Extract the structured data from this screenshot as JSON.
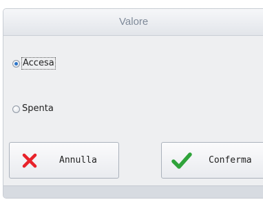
{
  "dialog": {
    "title": "Valore"
  },
  "options": [
    {
      "label": "Accesa",
      "checked": true
    },
    {
      "label": "Spenta",
      "checked": false
    }
  ],
  "buttons": {
    "cancel_label": "Annulla",
    "confirm_label": "Conferma"
  },
  "colors": {
    "cancel_icon": "#e8222a",
    "confirm_icon": "#2fa33a",
    "radio_selected": "#2a74c9"
  },
  "icons": {
    "cancel": "cross-icon",
    "confirm": "checkmark-icon"
  }
}
